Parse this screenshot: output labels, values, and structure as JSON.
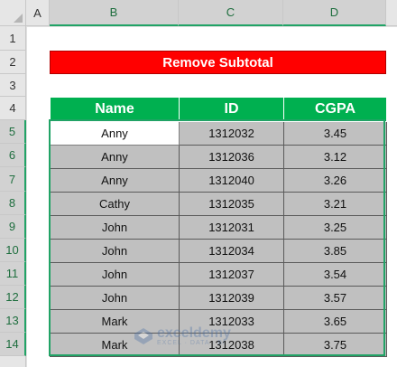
{
  "columns": [
    "A",
    "B",
    "C",
    "D"
  ],
  "rows": [
    "1",
    "2",
    "3",
    "4",
    "5",
    "6",
    "7",
    "8",
    "9",
    "10",
    "11",
    "12",
    "13",
    "14"
  ],
  "title": "Remove Subtotal",
  "table": {
    "headers": [
      "Name",
      "ID",
      "CGPA"
    ],
    "rows": [
      [
        "Anny",
        "1312032",
        "3.45"
      ],
      [
        "Anny",
        "1312036",
        "3.12"
      ],
      [
        "Anny",
        "1312040",
        "3.26"
      ],
      [
        "Cathy",
        "1312035",
        "3.21"
      ],
      [
        "John",
        "1312031",
        "3.25"
      ],
      [
        "John",
        "1312034",
        "3.85"
      ],
      [
        "John",
        "1312037",
        "3.54"
      ],
      [
        "John",
        "1312039",
        "3.57"
      ],
      [
        "Mark",
        "1312033",
        "3.65"
      ],
      [
        "Mark",
        "1312038",
        "3.75"
      ]
    ]
  },
  "watermark": {
    "name": "exceldemy",
    "tagline": "EXCEL · DATA · BI"
  },
  "colors": {
    "title_bg": "#ff0000",
    "header_bg": "#00b050",
    "cell_bg": "#c0c0c0",
    "selection": "#21a366"
  }
}
